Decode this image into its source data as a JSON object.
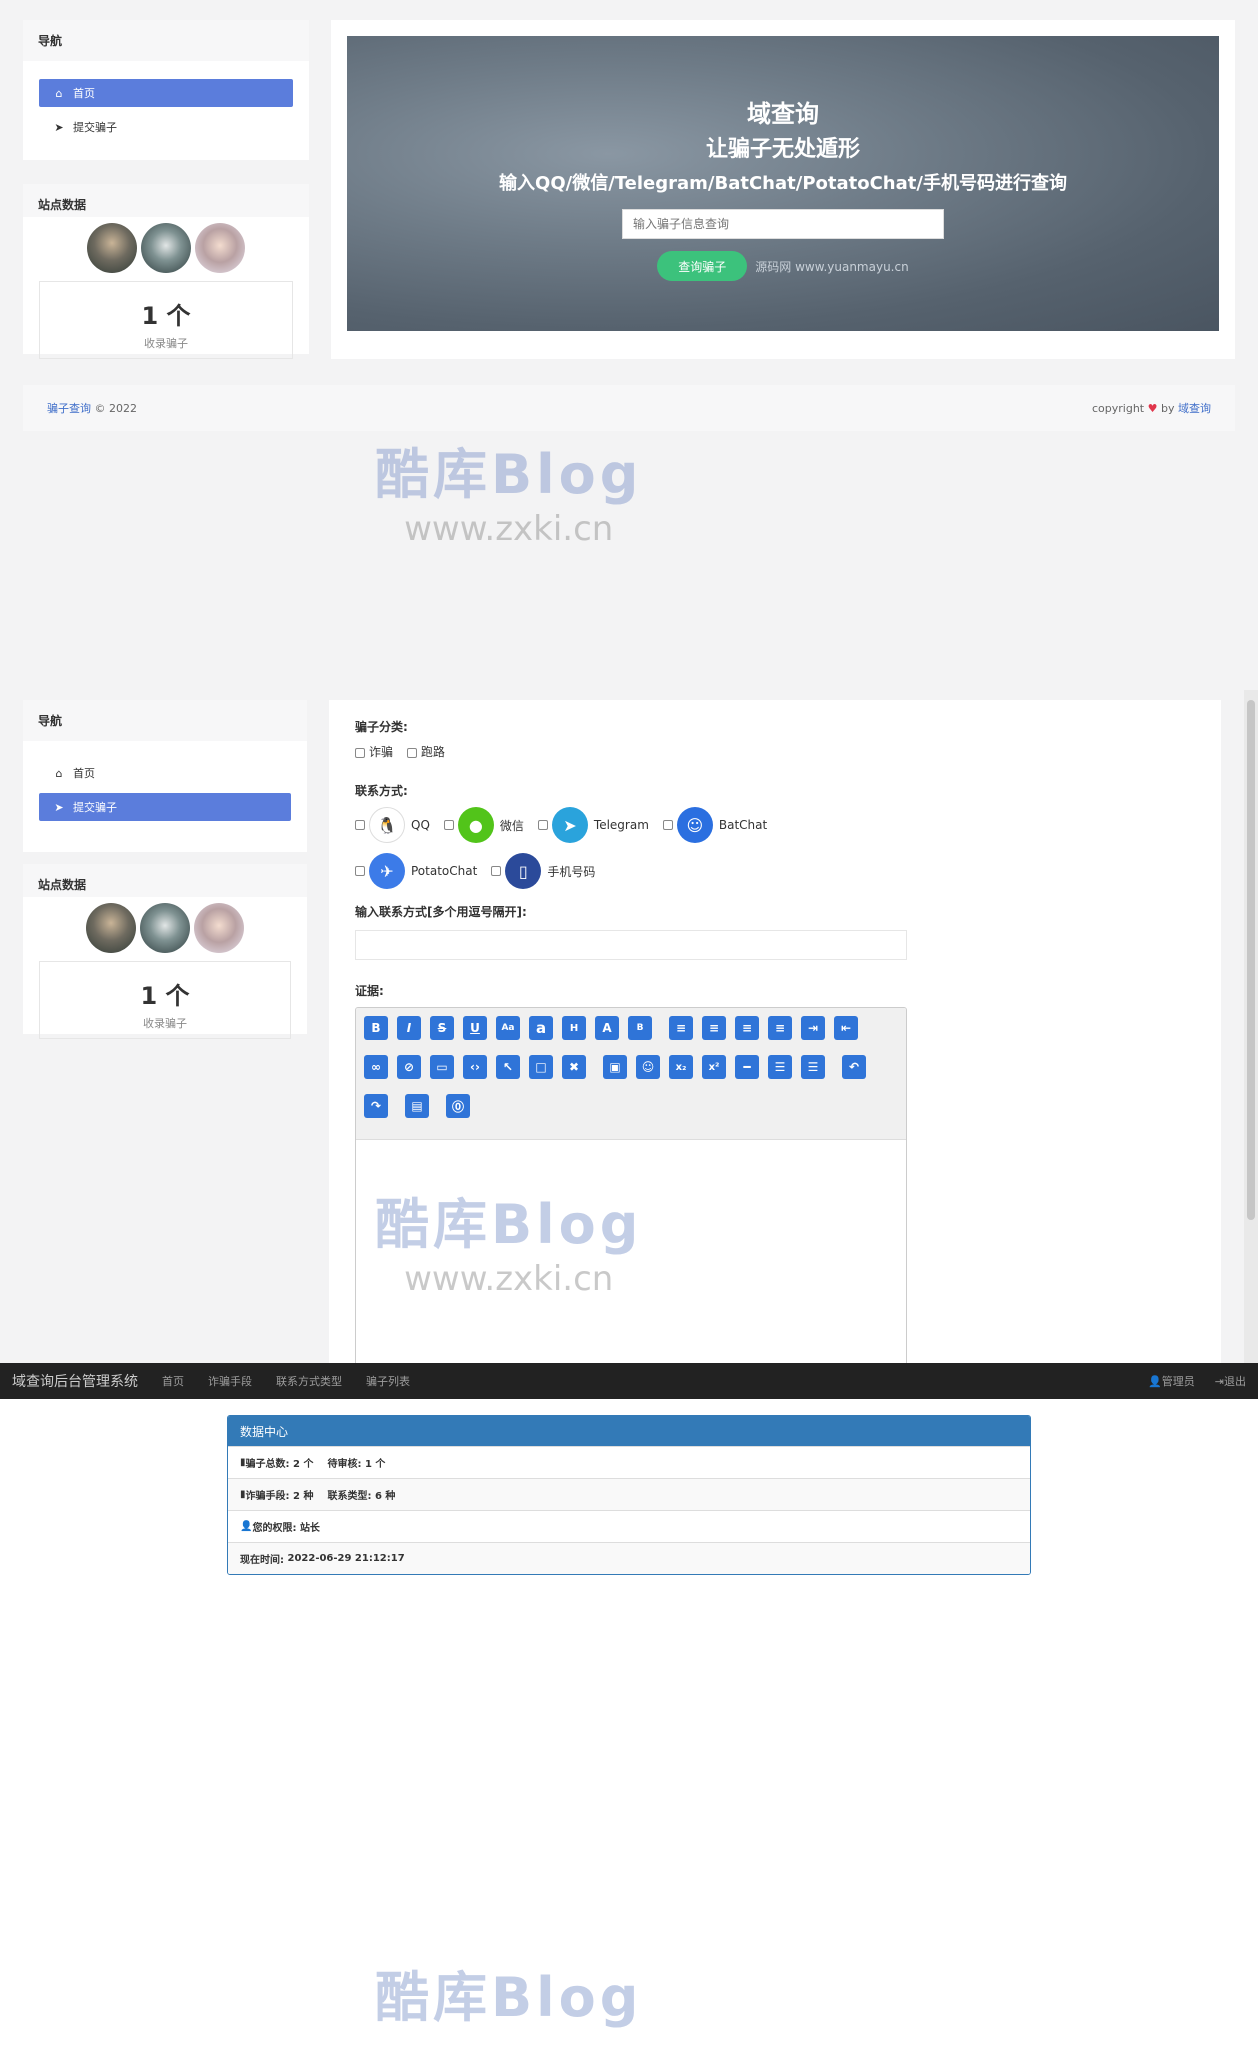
{
  "sec1": {
    "nav_title": "导航",
    "nav_items": [
      {
        "label": "首页",
        "active": true
      },
      {
        "label": "提交骗子",
        "active": false
      }
    ],
    "stats_title": "站点数据",
    "count_value": "1 个",
    "count_label": "收录骗子",
    "hero": {
      "site": "域查询",
      "slogan": "让骗子无处遁形",
      "sub": "输入QQ/微信/Telegram/BatChat/PotatoChat/手机号码进行查询",
      "placeholder": "输入骗子信息查询",
      "button": "查询骗子",
      "credit": "源码网  www.yuanmayu.cn"
    },
    "footer": {
      "brand_link": "骗子查询",
      "year": "© 2022",
      "copyright": "copyright",
      "by": "by",
      "author_link": "域查询"
    }
  },
  "sec2": {
    "nav_title": "导航",
    "nav_items": [
      {
        "label": "首页",
        "active": false
      },
      {
        "label": "提交骗子",
        "active": true
      }
    ],
    "stats_title": "站点数据",
    "count_value": "1 个",
    "count_label": "收录骗子",
    "form": {
      "category_label": "骗子分类:",
      "categories": [
        "诈骗",
        "跑路"
      ],
      "contact_label": "联系方式:",
      "contacts": [
        "QQ",
        "微信",
        "Telegram",
        "BatChat",
        "PotatoChat",
        "手机号码"
      ],
      "input_label": "输入联系方式[多个用逗号隔开]:",
      "evidence_label": "证据:"
    }
  },
  "sec3": {
    "brand": "域查询后台管理系统",
    "menu": [
      "首页",
      "诈骗手段",
      "联系方式类型",
      "骗子列表"
    ],
    "admin": "管理员",
    "logout": "退出",
    "panel_title": "数据中心",
    "rows": [
      {
        "a_label": "骗子总数:",
        "a_value": "2 个",
        "b_label": "待审核:",
        "b_value": "1 个"
      },
      {
        "a_label": "诈骗手段:",
        "a_value": "2 种",
        "b_label": "联系类型:",
        "b_value": "6 种"
      }
    ],
    "permission_label": "您的权限:",
    "permission_value": "站长",
    "time_label": "现在时间:",
    "time_value": "2022-06-29 21:12:17"
  },
  "watermark": {
    "title": "酷库Blog",
    "url": "www.zxki.cn"
  },
  "colors": {
    "accent": "#5b7ddc",
    "button_green": "#3cc27c",
    "panel_blue": "#337ab7",
    "toolbar_blue": "#2f74d8"
  }
}
